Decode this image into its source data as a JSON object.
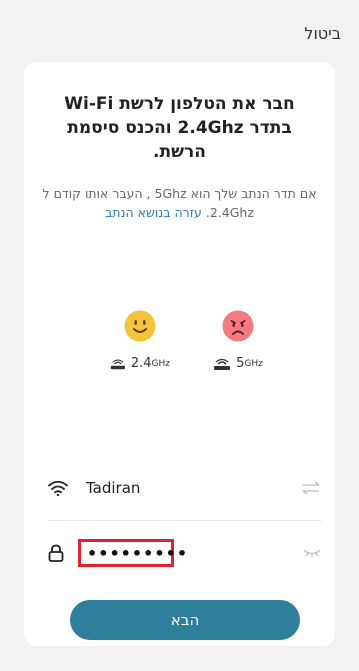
{
  "header": {
    "cancel_label": "ביטול"
  },
  "instructions": {
    "title": "חבר את הטלפון לרשת Wi-Fi בתדר 2.4Ghz והכנס סיסמת הרשת.",
    "description": "אם תדר הנתב שלך הוא 5Ghz , העבר אותו קודם ל 2.4Ghz.",
    "help_link": "עזרה בנושא הנתב"
  },
  "bands": [
    {
      "value": "2.4",
      "unit": "GHz",
      "status": "supported",
      "face_color": "#f3c33b"
    },
    {
      "value": "5",
      "unit": "GHz",
      "status": "not-supported",
      "face_color": "#f27a80"
    }
  ],
  "form": {
    "ssid": "Tadiran",
    "password_masked": "•••••••••"
  },
  "next_button": {
    "label": "הבא",
    "color": "#2d7f9c"
  },
  "icons": [
    "wifi-icon",
    "switch-network-icon",
    "lock-icon",
    "show-password-icon",
    "router-icon"
  ],
  "highlight_color": "#e0222e"
}
